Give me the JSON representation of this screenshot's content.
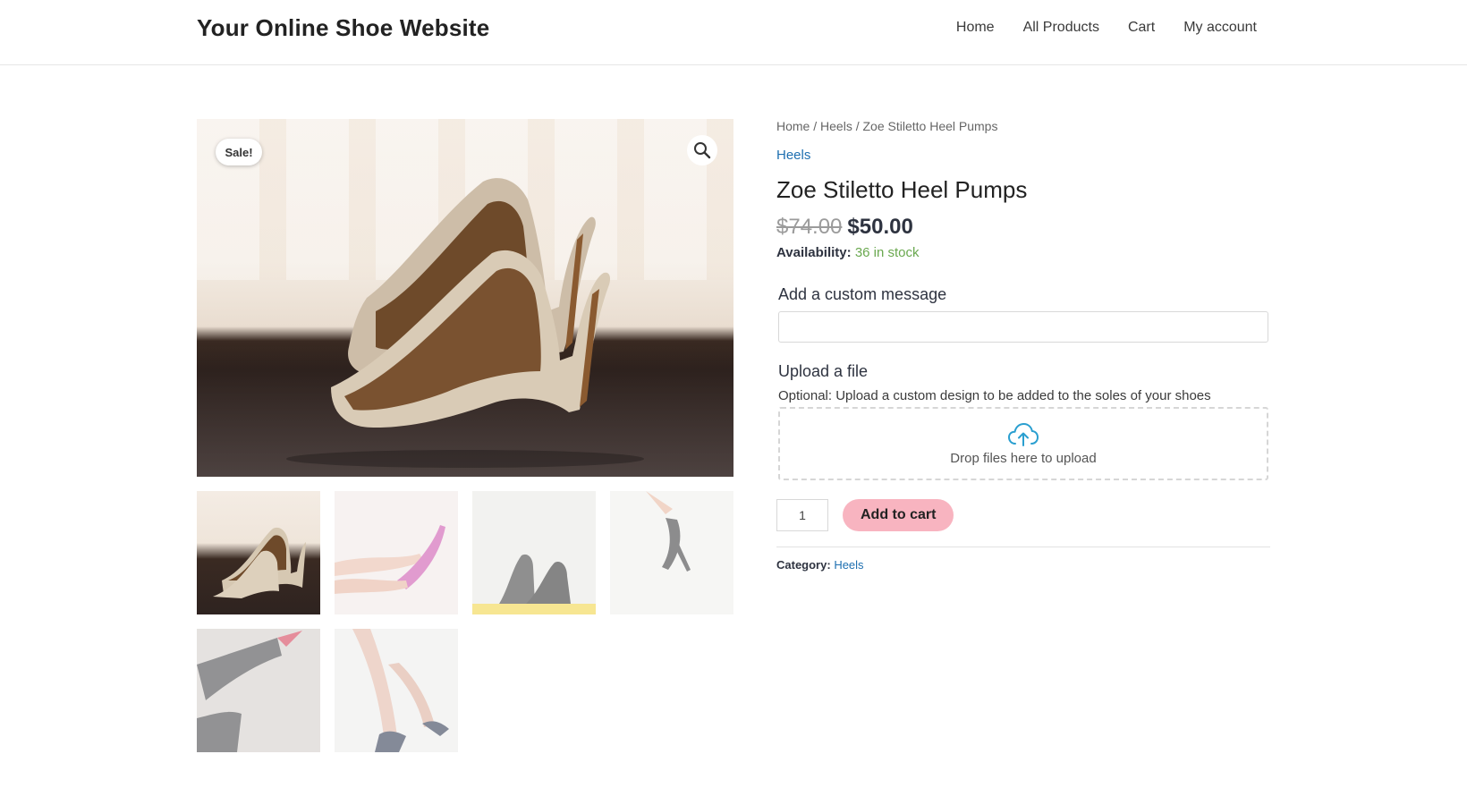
{
  "header": {
    "site_title": "Your Online Shoe Website",
    "nav": [
      "Home",
      "All Products",
      "Cart",
      "My account"
    ]
  },
  "gallery": {
    "sale_badge": "Sale!",
    "zoom_icon": "search-icon",
    "thumbnail_count": 6
  },
  "breadcrumb": {
    "items": [
      "Home",
      "Heels",
      "Zoe Stiletto Heel Pumps"
    ],
    "separator": "/"
  },
  "product": {
    "category_link": "Heels",
    "title": "Zoe Stiletto Heel Pumps",
    "old_price": "$74.00",
    "price": "$50.00",
    "availability_label": "Availability:",
    "stock": "36 in stock"
  },
  "custom_message": {
    "label": "Add a custom message",
    "value": ""
  },
  "upload": {
    "label": "Upload a file",
    "help": "Optional: Upload a custom design to be added to the soles of your shoes",
    "dropzone_text": "Drop files here to upload",
    "icon": "cloud-upload-icon"
  },
  "cart": {
    "quantity": "1",
    "add_label": "Add to cart"
  },
  "meta": {
    "category_label": "Category:",
    "category_value": "Heels"
  },
  "colors": {
    "accent_link": "#1e6fb0",
    "add_to_cart_bg": "#f8b4c0",
    "in_stock": "#6aa84f",
    "upload_icon": "#2a9fd0"
  }
}
